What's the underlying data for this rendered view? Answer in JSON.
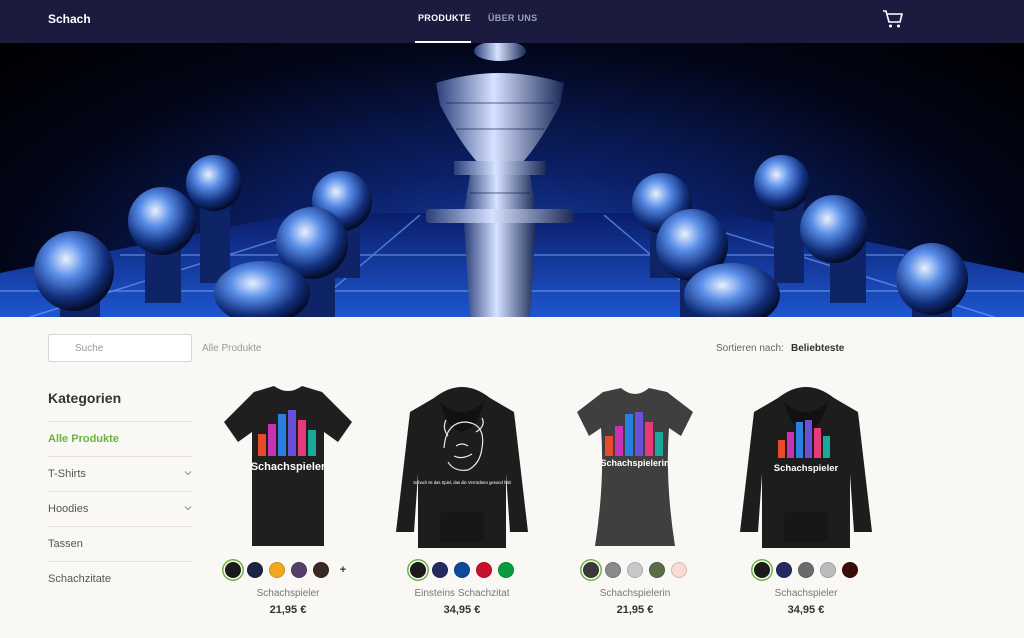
{
  "header": {
    "brand": "Schach",
    "tabs": [
      {
        "label": "PRODUKTE",
        "active": true
      },
      {
        "label": "ÜBER UNS",
        "active": false
      }
    ],
    "cart_icon": "shopping-cart-icon"
  },
  "hero": {
    "image": "chess-king-pieces-blue-hero"
  },
  "toolbar": {
    "search_placeholder": "Suche",
    "breadcrumb": "Alle Produkte",
    "sort_label": "Sortieren nach:",
    "sort_value": "Beliebteste"
  },
  "sidebar": {
    "heading": "Kategorien",
    "items": [
      {
        "label": "Alle Produkte",
        "active": true,
        "expandable": false
      },
      {
        "label": "T-Shirts",
        "active": false,
        "expandable": true
      },
      {
        "label": "Hoodies",
        "active": false,
        "expandable": true
      },
      {
        "label": "Tassen",
        "active": false,
        "expandable": false
      },
      {
        "label": "Schachzitate",
        "active": false,
        "expandable": false
      }
    ]
  },
  "products": [
    {
      "name": "Schachspieler",
      "price": "21,95 €",
      "print_text": "Schachspieler",
      "colors": [
        "#1b1b1b",
        "#1c2444",
        "#f0a91c",
        "#54406a",
        "#3a2a26"
      ],
      "more": "+"
    },
    {
      "name": "Einsteins Schachzitat",
      "price": "34,95 €",
      "print_text": "Schach ist das Spiel, das die Verrückten gesund hält",
      "colors": [
        "#1b1b1b",
        "#232a5e",
        "#0f4a9a",
        "#c8102e",
        "#0a9a3e"
      ],
      "more": ""
    },
    {
      "name": "Schachspielerin",
      "price": "21,95 €",
      "print_text": "Schachspielerin",
      "colors": [
        "#3a3a3a",
        "#8a8a8a",
        "#c8c8c8",
        "#5a6e4a",
        "#f7dcd6"
      ],
      "more": ""
    },
    {
      "name": "Schachspieler",
      "price": "34,95 €",
      "print_text": "Schachspieler",
      "colors": [
        "#1b1b1b",
        "#232a5e",
        "#6b6b6b",
        "#bdbdbd",
        "#3a0e06"
      ],
      "more": ""
    }
  ],
  "colors": {
    "header_bg": "#1a1b3f",
    "accent": "#6db33f",
    "page_bg": "#faf8f4"
  }
}
